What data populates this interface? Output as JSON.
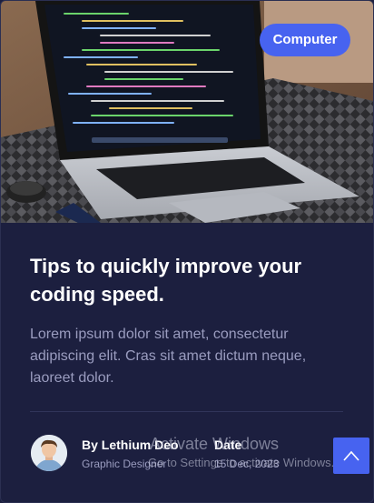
{
  "post": {
    "category": "Computer",
    "title": "Tips to quickly improve your coding speed.",
    "excerpt": "Lorem ipsum dolor sit amet, consectetur adipiscing elit. Cras sit amet dictum neque, laoreet dolor."
  },
  "author": {
    "name": "By Lethium Deo",
    "role": "Graphic Designer"
  },
  "date": {
    "label": "Date",
    "value": "15 Dec, 2023"
  },
  "watermark": {
    "line1": "Activate Windows",
    "line2": "Go to Settings to activate Windows."
  },
  "icons": {
    "scroll_top": "chevron-up-icon",
    "hero": "laptop-photo"
  },
  "colors": {
    "background": "#1c1f3f",
    "accent": "#4763f0",
    "muted_text": "#9a9cbf"
  }
}
